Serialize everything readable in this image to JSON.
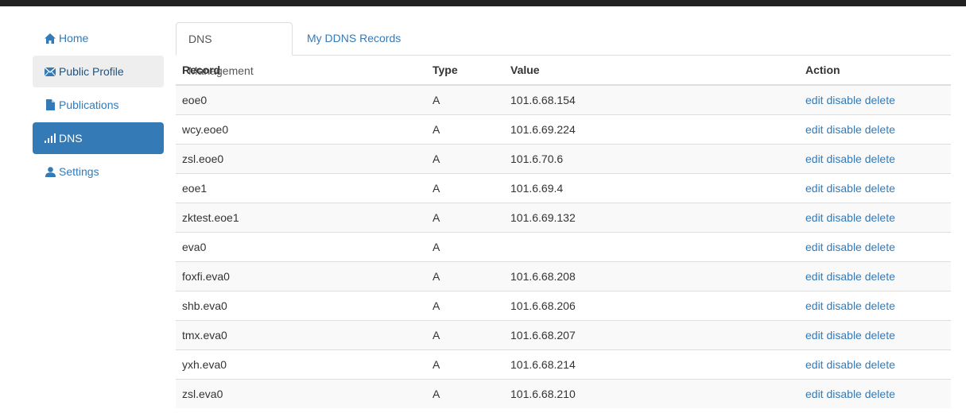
{
  "sidebar": {
    "items": [
      {
        "label": "Home",
        "icon": "home-icon"
      },
      {
        "label": "Public Profile",
        "icon": "envelope-icon"
      },
      {
        "label": "Publications",
        "icon": "file-icon"
      },
      {
        "label": "DNS",
        "icon": "signal-icon"
      },
      {
        "label": "Settings",
        "icon": "user-icon"
      }
    ],
    "active": "DNS",
    "hovered": "Public Profile"
  },
  "tabs": [
    {
      "label": "DNS Management",
      "active": true
    },
    {
      "label": "My DDNS Records",
      "active": false
    }
  ],
  "table": {
    "headers": {
      "record": "Record",
      "type": "Type",
      "value": "Value",
      "action": "Action"
    },
    "rows": [
      {
        "record": "eoe0",
        "type": "A",
        "value": "101.6.68.154"
      },
      {
        "record": "wcy.eoe0",
        "type": "A",
        "value": "101.6.69.224"
      },
      {
        "record": "zsl.eoe0",
        "type": "A",
        "value": "101.6.70.6"
      },
      {
        "record": "eoe1",
        "type": "A",
        "value": "101.6.69.4"
      },
      {
        "record": "zktest.eoe1",
        "type": "A",
        "value": "101.6.69.132"
      },
      {
        "record": "eva0",
        "type": "A",
        "value": ""
      },
      {
        "record": "foxfi.eva0",
        "type": "A",
        "value": "101.6.68.208"
      },
      {
        "record": "shb.eva0",
        "type": "A",
        "value": "101.6.68.206"
      },
      {
        "record": "tmx.eva0",
        "type": "A",
        "value": "101.6.68.207"
      },
      {
        "record": "yxh.eva0",
        "type": "A",
        "value": "101.6.68.214"
      },
      {
        "record": "zsl.eva0",
        "type": "A",
        "value": "101.6.68.210"
      }
    ],
    "actions": {
      "edit": "edit",
      "disable": "disable",
      "delete": "delete"
    }
  },
  "colors": {
    "link": "#337ab7",
    "active_nav_bg": "#337ab7",
    "hover_nav_bg": "#eeeeee",
    "stripe": "#f9f9f9",
    "border": "#dddddd",
    "topbar": "#222222"
  }
}
